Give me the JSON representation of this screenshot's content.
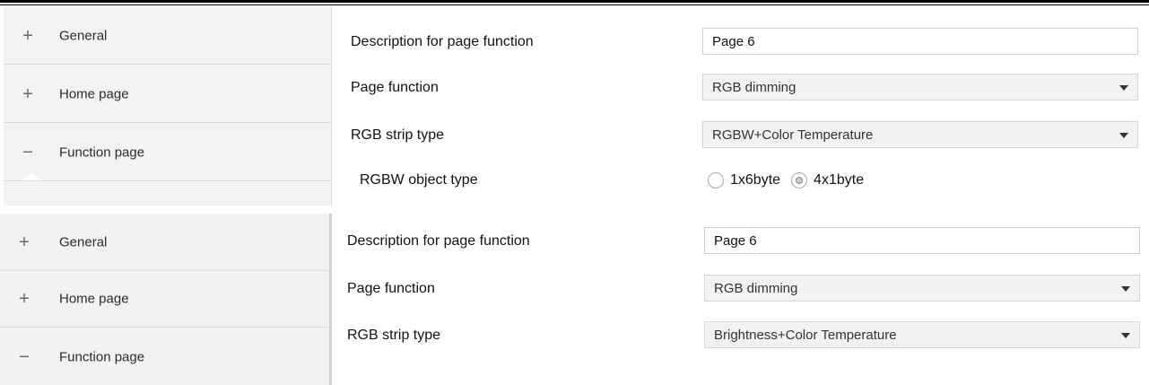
{
  "panels": [
    {
      "sidebar": {
        "items": [
          {
            "symbol": "+",
            "label": "General"
          },
          {
            "symbol": "+",
            "label": "Home page"
          },
          {
            "symbol": "−",
            "label": "Function page"
          }
        ]
      },
      "form": {
        "description_label": "Description for page function",
        "description_value": "Page 6",
        "page_function_label": "Page function",
        "page_function_value": "RGB dimming",
        "strip_type_label": "RGB strip type",
        "strip_type_value": "RGBW+Color Temperature",
        "object_type_label": "RGBW object type",
        "object_type_options": [
          "1x6byte",
          "4x1byte"
        ],
        "object_type_selected": "4x1byte"
      }
    },
    {
      "sidebar": {
        "items": [
          {
            "symbol": "+",
            "label": "General"
          },
          {
            "symbol": "+",
            "label": "Home page"
          },
          {
            "symbol": "−",
            "label": "Function page"
          }
        ]
      },
      "form": {
        "description_label": "Description for page function",
        "description_value": "Page 6",
        "page_function_label": "Page function",
        "page_function_value": "RGB dimming",
        "strip_type_label": "RGB strip type",
        "strip_type_value": "Brightness+Color Temperature"
      }
    }
  ]
}
